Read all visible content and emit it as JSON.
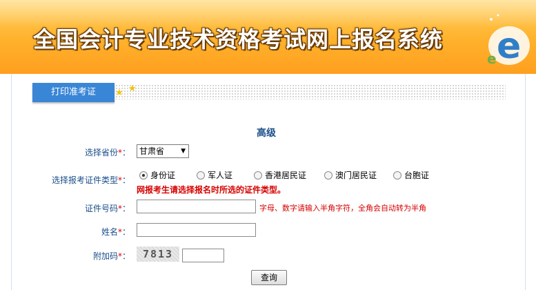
{
  "header": {
    "title": "全国会计专业技术资格考试网上报名系统"
  },
  "tab": {
    "label": "打印准考证"
  },
  "level": "高级",
  "form": {
    "province_label": "选择省份",
    "province_value": "甘肃省",
    "id_type_label": "选择报考证件类型",
    "id_types": [
      "身份证",
      "军人证",
      "香港居民证",
      "澳门居民证",
      "台胞证"
    ],
    "id_type_selected": "身份证",
    "id_type_warning": "网报考生请选择报名时所选的证件类型。",
    "id_number_label": "证件号码",
    "id_number_value": "",
    "id_number_hint": "字母、数字请输入半角字符，全角会自动转为半角",
    "name_label": "姓名",
    "name_value": "",
    "captcha_label": "附加码",
    "captcha_code": "7813",
    "captcha_value": "",
    "required_mark": "*",
    "submit_label": "查询"
  },
  "colors": {
    "banner": "#ffb12c",
    "tab": "#3a86d6",
    "label": "#1a4e8a",
    "required": "#d60000"
  }
}
